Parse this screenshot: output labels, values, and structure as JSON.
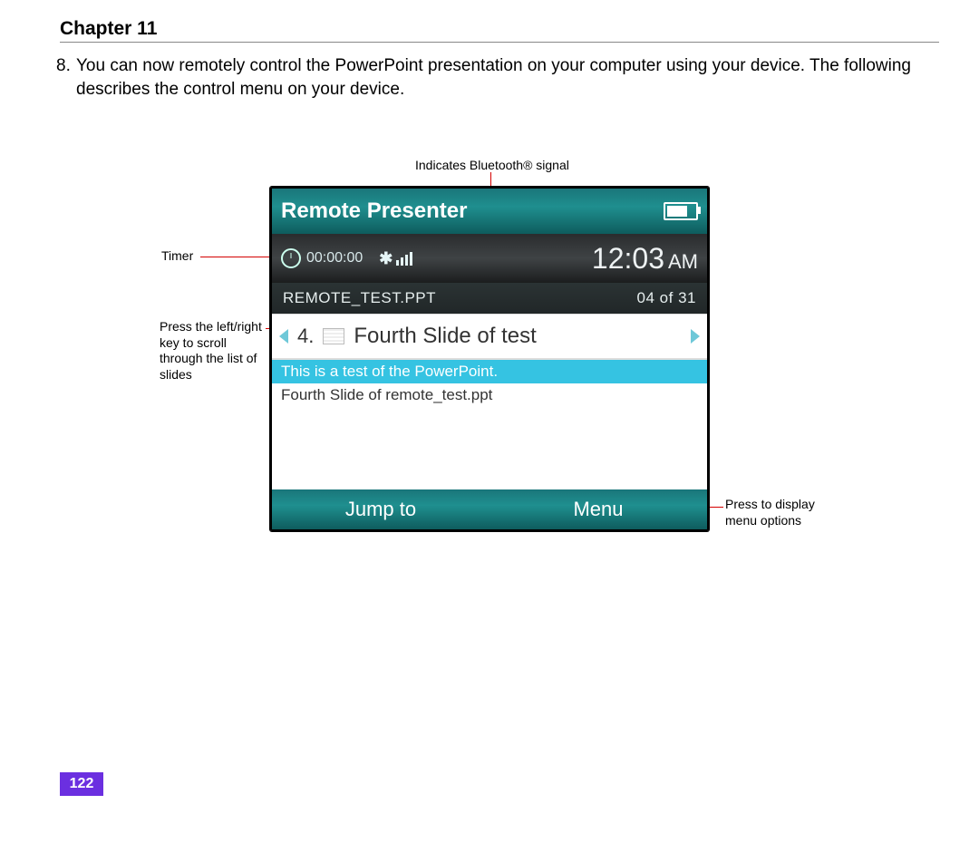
{
  "header": {
    "chapter": "Chapter 11"
  },
  "body": {
    "list_number": "8.",
    "para": "You can now remotely control the PowerPoint presentation on your computer using your device. The following describes the control menu on your device."
  },
  "callouts": {
    "bluetooth": "Indicates Bluetooth® signal",
    "timer": "Timer",
    "scroll": "Press the left/right key to scroll through the list of slides",
    "menu": "Press to display menu options"
  },
  "device": {
    "title": "Remote Presenter",
    "timer": "00:00:00",
    "clock": "12:03",
    "ampm": "AM",
    "filename": "REMOTE_TEST.PPT",
    "slide_pos": "04 of 31",
    "slide_number": "4.",
    "slide_title": "Fourth Slide of test",
    "note_highlight": "This is a test of the PowerPoint.",
    "note_plain": "Fourth Slide of remote_test.ppt",
    "softkey_left": "Jump to",
    "softkey_right": "Menu"
  },
  "page_number": "122"
}
